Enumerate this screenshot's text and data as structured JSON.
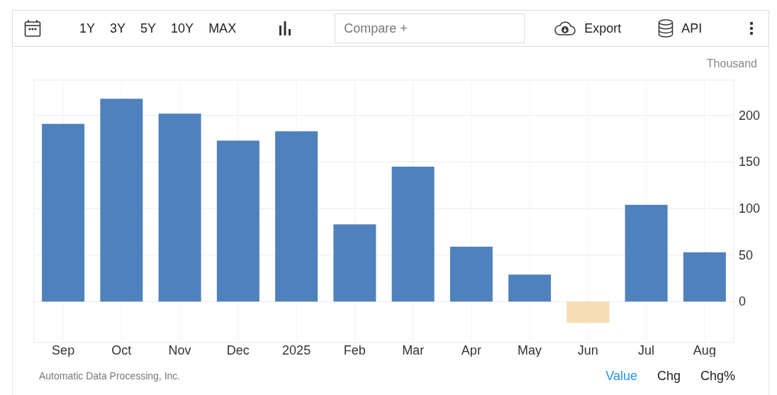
{
  "toolbar": {
    "ranges": [
      {
        "label": "1Y"
      },
      {
        "label": "3Y"
      },
      {
        "label": "5Y"
      },
      {
        "label": "10Y"
      },
      {
        "label": "MAX"
      }
    ],
    "compare": {
      "placeholder": "Compare +"
    },
    "export": "Export",
    "api": "API"
  },
  "chart": {
    "unit": "Thousand",
    "chart_data": {
      "type": "bar",
      "categories": [
        "Sep",
        "Oct",
        "Nov",
        "Dec",
        "2025",
        "Feb",
        "Mar",
        "Apr",
        "May",
        "Jun",
        "Jul",
        "Aug"
      ],
      "series": [
        {
          "color": "#4f81bd",
          "values": [
            191,
            218,
            202,
            173,
            183,
            83,
            145,
            59,
            29,
            null,
            104,
            53
          ]
        },
        {
          "color": "#f5deb3",
          "values": [
            null,
            null,
            null,
            null,
            null,
            null,
            null,
            null,
            null,
            -23,
            null,
            null
          ]
        }
      ],
      "stacked": true,
      "grid": true,
      "ylim": [
        -44,
        238
      ],
      "yticks": [
        0,
        50,
        100,
        150,
        200
      ]
    }
  },
  "footer": {
    "source": "Automatic Data Processing, Inc.",
    "modes": [
      {
        "label": "Value",
        "selected": true
      },
      {
        "label": "Chg",
        "selected": false
      },
      {
        "label": "Chg%",
        "selected": false
      }
    ]
  }
}
